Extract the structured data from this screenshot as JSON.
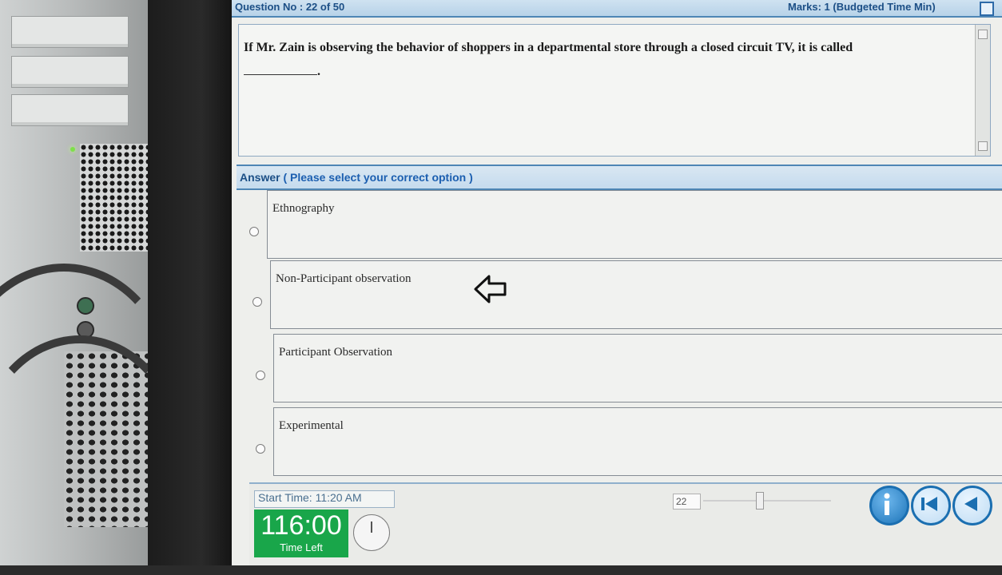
{
  "question": {
    "number_label": "Question No : 22 of 50",
    "marks_label": "Marks: 1 (Budgeted Time Min)",
    "text": "If Mr. Zain is observing the behavior of shoppers in a departmental store through a closed circuit TV, it is called",
    "blank_suffix": "."
  },
  "answer": {
    "title": "Answer",
    "hint": "( Please select your correct option )",
    "options": [
      {
        "label": "Ethnography",
        "selected": false
      },
      {
        "label": "Non-Participant observation",
        "selected": false
      },
      {
        "label": "Participant Observation",
        "selected": false
      },
      {
        "label": "Experimental",
        "selected": false
      }
    ]
  },
  "footer": {
    "start_time": "Start Time: 11:20 AM",
    "time_left_value": "116:00",
    "time_left_label": "Time Left",
    "page_number": "22"
  },
  "icons": {
    "pointer": "left-arrow-outline-icon",
    "info": "info-icon",
    "first": "skip-first-icon",
    "prev": "previous-icon"
  },
  "colors": {
    "accent": "#1c4f86",
    "timer": "#19a64a",
    "nav": "#1b6fb1"
  }
}
